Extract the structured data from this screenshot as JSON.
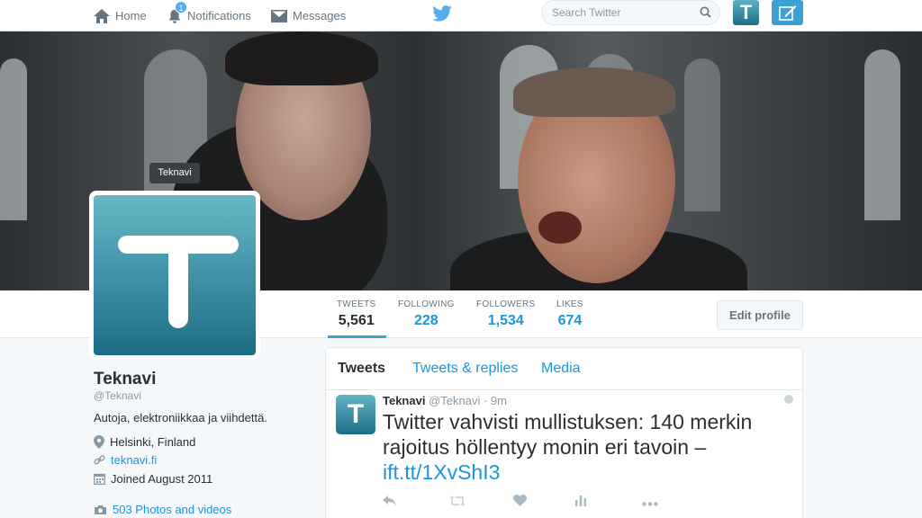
{
  "nav": {
    "home_label": "Home",
    "notifications_label": "Notifications",
    "notifications_count": "1",
    "messages_label": "Messages",
    "search_placeholder": "Search Twitter",
    "avatar_letter": "T"
  },
  "profile": {
    "avatar_tooltip": "Teknavi",
    "name": "Teknavi",
    "handle": "@Teknavi",
    "bio": "Autoja, elektroniikkaa ja viihdettä.",
    "location": "Helsinki, Finland",
    "website": "teknavi.fi",
    "joined": "Joined August 2011",
    "photos": "503 Photos and videos"
  },
  "stats": [
    {
      "label": "TWEETS",
      "value": "5,561"
    },
    {
      "label": "FOLLOWING",
      "value": "228"
    },
    {
      "label": "FOLLOWERS",
      "value": "1,534"
    },
    {
      "label": "LIKES",
      "value": "674"
    }
  ],
  "edit_profile_label": "Edit profile",
  "timeline": {
    "tabs": [
      "Tweets",
      "Tweets & replies",
      "Media"
    ],
    "tweet": {
      "avatar_letter": "T",
      "name": "Teknavi",
      "handle": "@Teknavi",
      "time": "· 9m",
      "text": "Twitter vahvisti mullistuksen: 140 merkin rajoitus höllentyy monin eri tavoin –",
      "link": "ift.tt/1XvShI3"
    }
  },
  "colors": {
    "accent": "#1b95e0",
    "brand_teal": "#1c6d84"
  }
}
